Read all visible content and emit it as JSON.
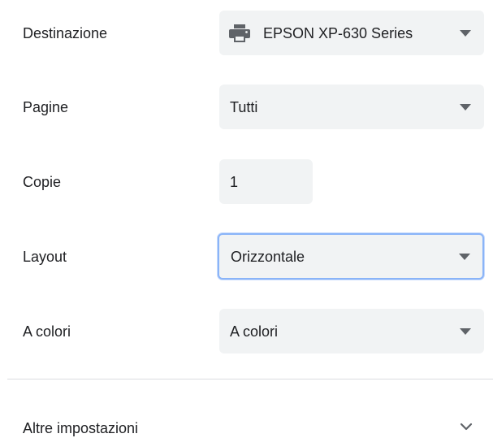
{
  "settings": {
    "destination": {
      "label": "Destinazione",
      "value": "EPSON XP-630 Series",
      "icon": "printer-icon"
    },
    "pages": {
      "label": "Pagine",
      "value": "Tutti"
    },
    "copies": {
      "label": "Copie",
      "value": "1"
    },
    "layout": {
      "label": "Layout",
      "value": "Orizzontale"
    },
    "color": {
      "label": "A colori",
      "value": "A colori"
    }
  },
  "more_settings": {
    "label": "Altre impostazioni",
    "icon": "chevron-down-icon"
  },
  "colors": {
    "field_background": "#f1f3f4",
    "focus_ring": "#8ab4f8",
    "text": "#202124",
    "icon": "#5f6368",
    "divider": "#dadce0"
  }
}
